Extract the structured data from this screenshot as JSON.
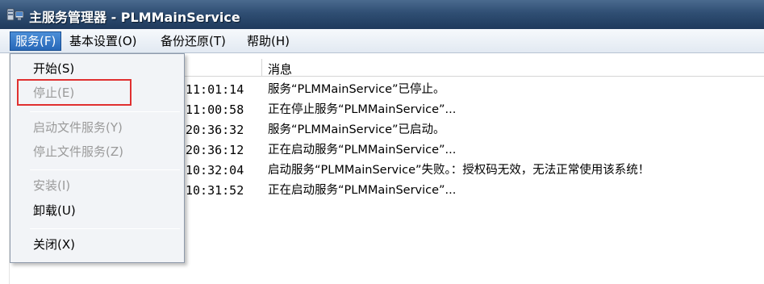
{
  "window": {
    "title": "主服务管理器 - PLMMainService",
    "icon": "server-app-icon"
  },
  "menubar": {
    "items": [
      {
        "label": "服务(F)",
        "active": true
      },
      {
        "label": "基本设置(O)",
        "active": false
      },
      {
        "label": "备份还原(T)",
        "active": false
      },
      {
        "label": "帮助(H)",
        "active": false
      }
    ]
  },
  "dropdown": {
    "items": [
      {
        "label": "开始(S)",
        "enabled": true
      },
      {
        "label": "停止(E)",
        "enabled": false
      },
      {
        "label": "启动文件服务(Y)",
        "enabled": false
      },
      {
        "label": "停止文件服务(Z)",
        "enabled": false
      },
      {
        "label": "安装(I)",
        "enabled": false
      },
      {
        "label": "卸载(U)",
        "enabled": true
      },
      {
        "label": "关闭(X)",
        "enabled": true
      }
    ],
    "highlight_color": "#e03030"
  },
  "log": {
    "header_message": "消息",
    "rows": [
      {
        "time": "11:01:14",
        "message": "服务“PLMMainService”已停止。"
      },
      {
        "time": "11:00:58",
        "message": "正在停止服务“PLMMainService”..."
      },
      {
        "time": "20:36:32",
        "message": "服务“PLMMainService”已启动。"
      },
      {
        "time": "20:36:12",
        "message": "正在启动服务“PLMMainService”..."
      },
      {
        "time": "10:32:04",
        "message": "启动服务“PLMMainService”失败。：授权码无效，无法正常使用该系统！"
      },
      {
        "time": "10:31:52",
        "message": "正在启动服务“PLMMainService”..."
      }
    ]
  },
  "colors": {
    "titlebar": "#2f4e73",
    "menu_active": "#2667b8",
    "disabled_text": "#9a9a9a"
  }
}
